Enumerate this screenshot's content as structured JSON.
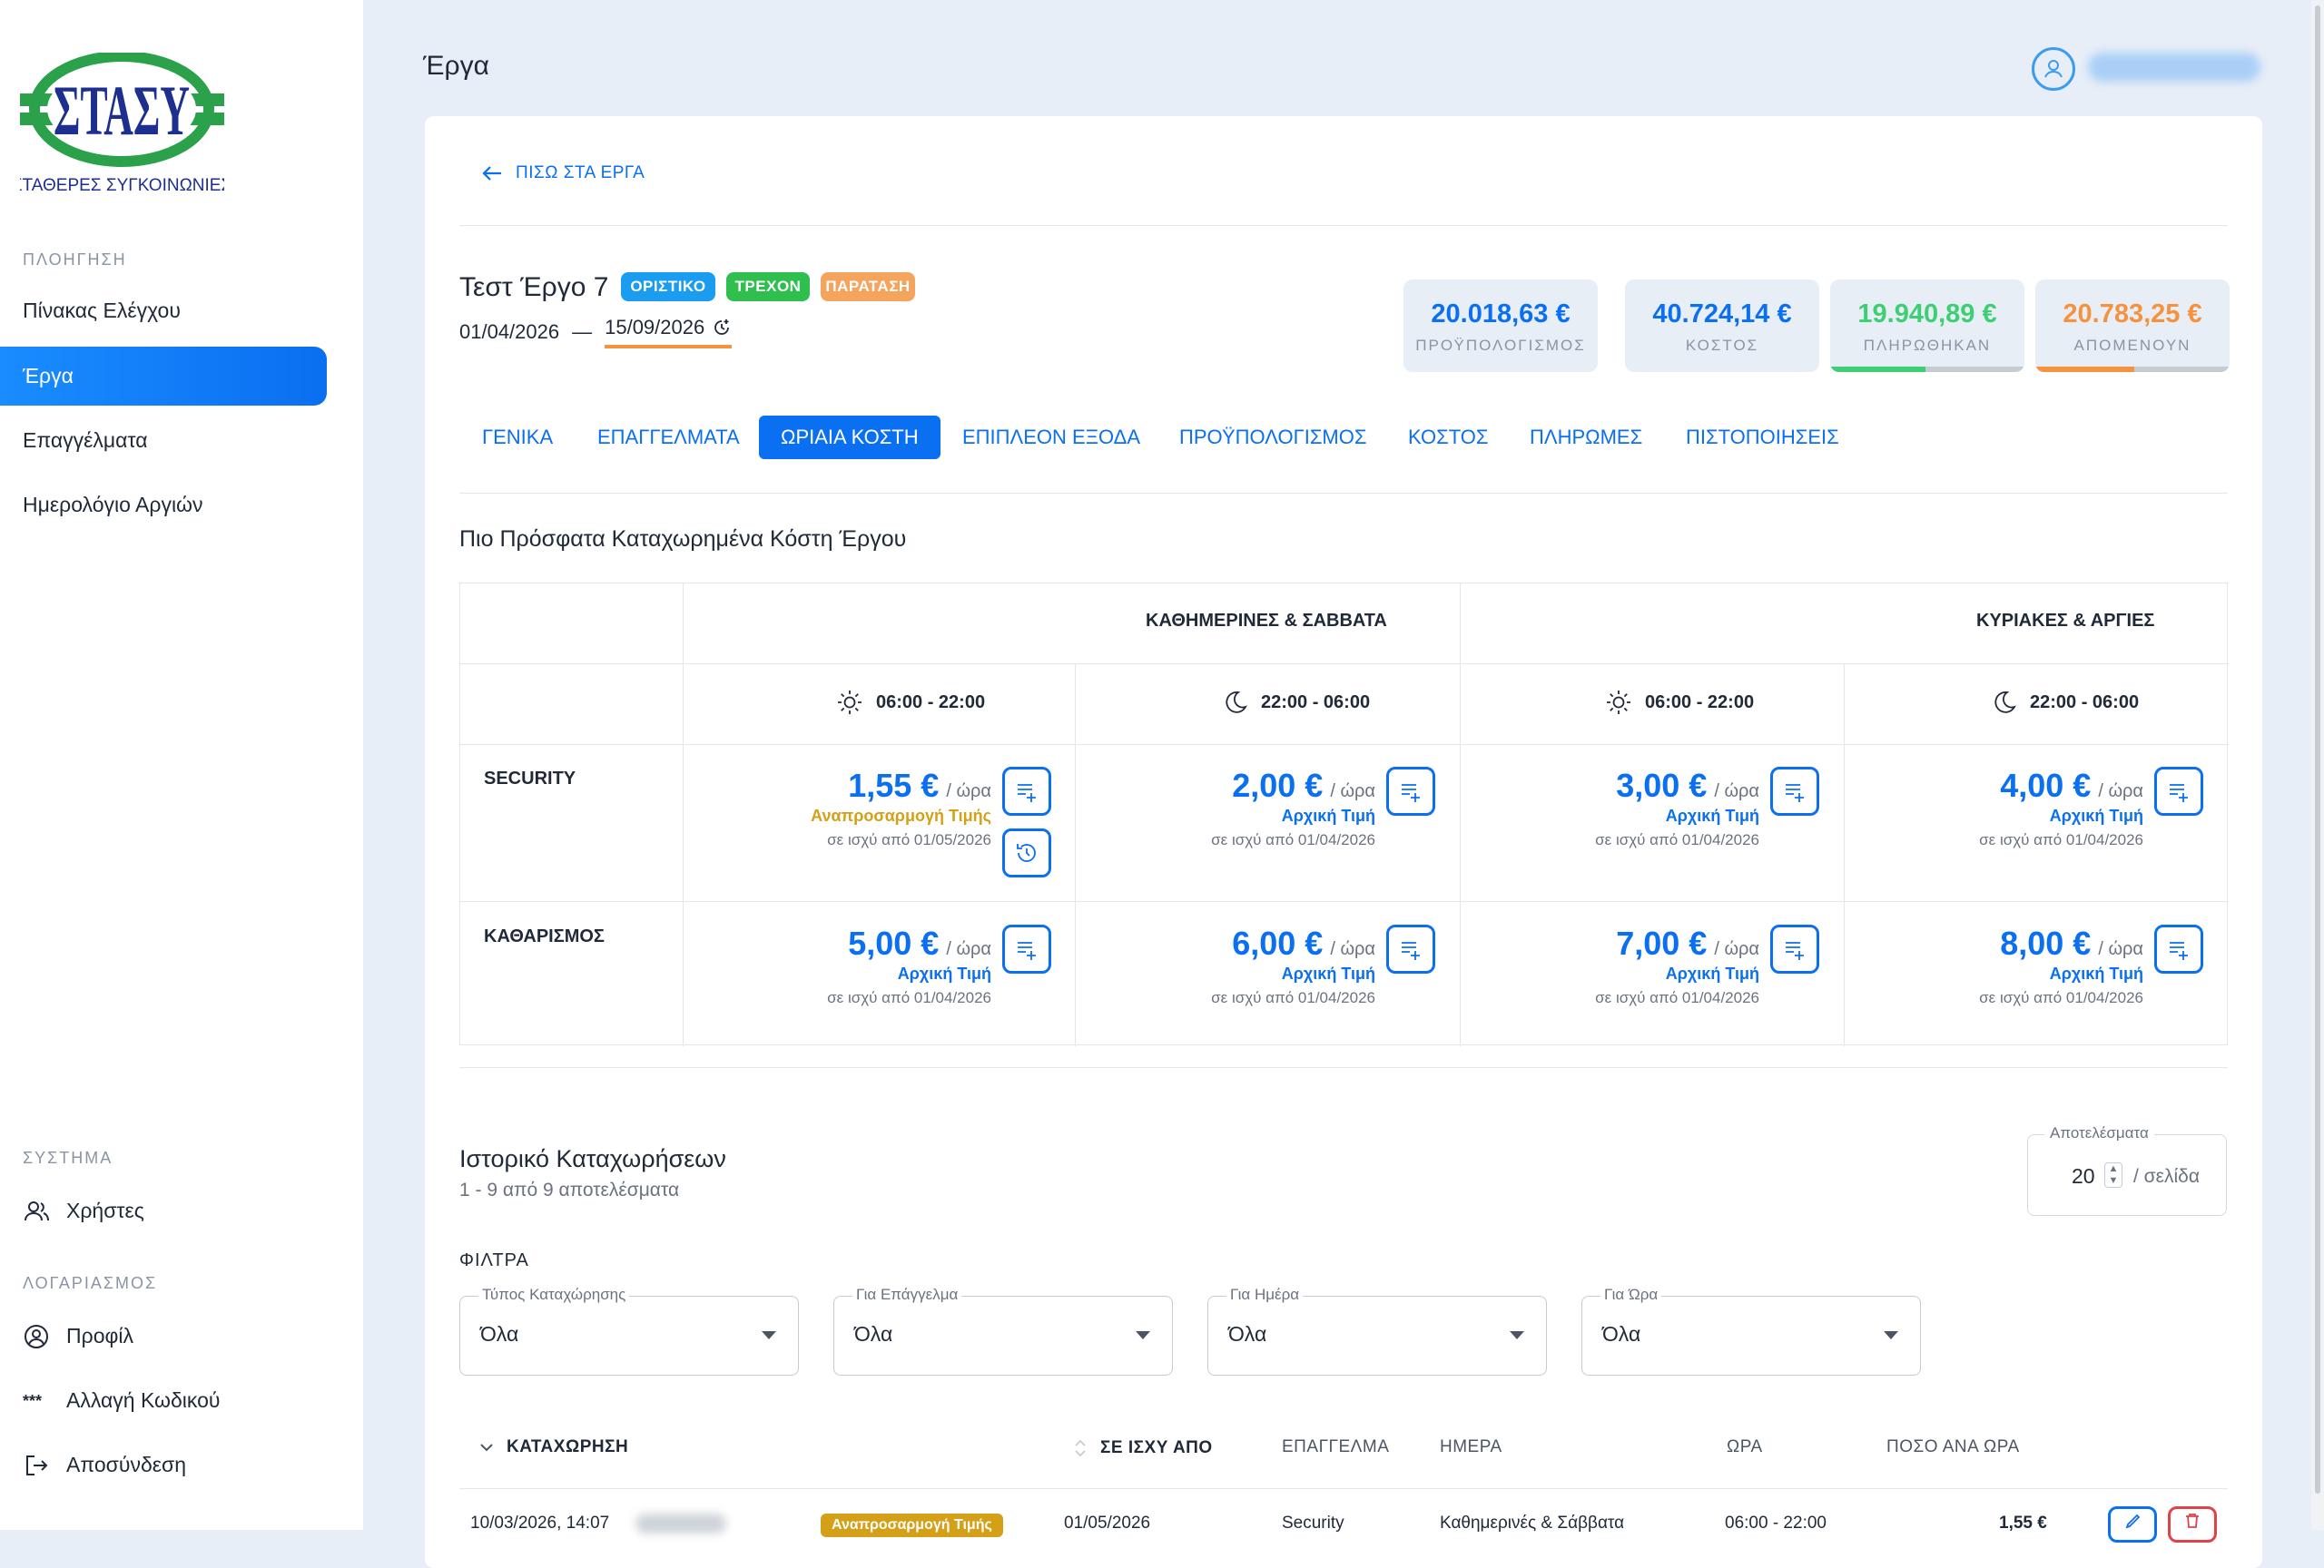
{
  "logo": {
    "text": "ΣΤΑΣΥ",
    "subtitle": "ΣΤΑΘΕΡΕΣ ΣΥΓΚΟΙΝΩΝΙΕΣ"
  },
  "sidebar": {
    "nav_title": "ΠΛΟΗΓΗΣΗ",
    "nav_items": [
      "Πίνακας Ελέγχου",
      "Έργα",
      "Επαγγέλματα",
      "Ημερολόγιο Αργιών"
    ],
    "system_title": "ΣΥΣΤΗΜΑ",
    "system_items": [
      "Χρήστες"
    ],
    "account_title": "ΛΟΓΑΡΙΑΣΜΟΣ",
    "account_items": [
      "Προφίλ",
      "Αλλαγή Κωδικού",
      "Αποσύνδεση"
    ]
  },
  "header": {
    "title": "Έργα"
  },
  "back_link": "ΠΙΣΩ ΣΤΑ ΕΡΓΑ",
  "project": {
    "title": "Τεστ Έργο 7",
    "badges": [
      "ΟΡΙΣΤΙΚΟ",
      "ΤΡΕΧΟΝ",
      "ΠΑΡΑΤΑΣΗ"
    ],
    "start_date": "01/04/2026",
    "separator": "—",
    "end_date": "15/09/2026"
  },
  "stats": [
    {
      "value": "20.018,63 €",
      "label": "ΠΡΟΫΠΟΛΟΓΙΣΜΟΣ",
      "color": "#0a6ff0"
    },
    {
      "value": "40.724,14 €",
      "label": "ΚΟΣΤΟΣ",
      "color": "#0a6ff0"
    },
    {
      "value": "19.940,89 €",
      "label": "ΠΛΗΡΩΘΗΚΑΝ",
      "color": "#3ecf74",
      "progress": 0.49
    },
    {
      "value": "20.783,25 €",
      "label": "ΑΠΟΜΕΝΟΥΝ",
      "color": "#f5923e",
      "progress": 0.51
    }
  ],
  "tabs": [
    "ΓΕΝΙΚΑ",
    "ΕΠΑΓΓΕΛΜΑΤΑ",
    "ΩΡΙΑΙΑ ΚΟΣΤΗ",
    "ΕΠΙΠΛΕΟΝ ΕΞΟΔΑ",
    "ΠΡΟΫΠΟΛΟΓΙΣΜΟΣ",
    "ΚΟΣΤΟΣ",
    "ΠΛΗΡΩΜΕΣ",
    "ΠΙΣΤΟΠΟΙΗΣΕΙΣ"
  ],
  "active_tab": "ΩΡΙΑΙΑ ΚΟΣΤΗ",
  "recent": {
    "title": "Πιο Πρόσφατα Καταχωρημένα Κόστη Έργου",
    "groups": [
      "ΚΑΘΗΜΕΡΙΝΕΣ & ΣΑΒΒΑΤΑ",
      "ΚΥΡΙΑΚΕΣ & ΑΡΓΙΕΣ"
    ],
    "periods": [
      "06:00 - 22:00",
      "22:00 - 06:00",
      "06:00 - 22:00",
      "22:00 - 06:00"
    ],
    "per_hour": "/ ώρα",
    "rows": [
      {
        "name": "SECURITY",
        "cells": [
          {
            "amount": "1,55 €",
            "tag": "Αναπροσαρμογή Τιμής",
            "since": "σε ισχύ από 01/05/2026"
          },
          {
            "amount": "2,00 €",
            "tag": "Αρχική Τιμή",
            "since": "σε ισχύ από 01/04/2026"
          },
          {
            "amount": "3,00 €",
            "tag": "Αρχική Τιμή",
            "since": "σε ισχύ από 01/04/2026"
          },
          {
            "amount": "4,00 €",
            "tag": "Αρχική Τιμή",
            "since": "σε ισχύ από 01/04/2026"
          }
        ]
      },
      {
        "name": "ΚΑΘΑΡΙΣΜΟΣ",
        "cells": [
          {
            "amount": "5,00 €",
            "tag": "Αρχική Τιμή",
            "since": "σε ισχύ από 01/04/2026"
          },
          {
            "amount": "6,00 €",
            "tag": "Αρχική Τιμή",
            "since": "σε ισχύ από 01/04/2026"
          },
          {
            "amount": "7,00 €",
            "tag": "Αρχική Τιμή",
            "since": "σε ισχύ από 01/04/2026"
          },
          {
            "amount": "8,00 €",
            "tag": "Αρχική Τιμή",
            "since": "σε ισχύ από 01/04/2026"
          }
        ]
      }
    ],
    "colors": {
      "adjust": "#d4a017",
      "initial": "#0a6ff0"
    }
  },
  "history": {
    "title": "Ιστορικό Καταχωρήσεων",
    "subtitle": "1 - 9 από 9 αποτελέσματα",
    "per_page_label": "Αποτελέσματα",
    "per_page_value": "20",
    "per_page_suffix": "/ σελίδα",
    "filters_title": "ΦΙΛΤΡΑ",
    "filters": [
      {
        "label": "Τύπος Καταχώρησης",
        "value": "Όλα"
      },
      {
        "label": "Για Επάγγελμα",
        "value": "Όλα"
      },
      {
        "label": "Για Ημέρα",
        "value": "Όλα"
      },
      {
        "label": "Για Ώρα",
        "value": "Όλα"
      }
    ],
    "columns": [
      "ΚΑΤΑΧΩΡΗΣΗ",
      "ΣΕ ΙΣΧΥ ΑΠΟ",
      "ΕΠΑΓΓΕΛΜΑ",
      "ΗΜΕΡΑ",
      "ΩΡΑ",
      "ΠΟΣΟ ΑΝΑ ΩΡΑ"
    ],
    "first_row": {
      "entry": "10/03/2026, 14:07 ",
      "tag": "Αναπροσαρμογή Τιμής",
      "since": "01/05/2026",
      "trade": "Security",
      "day": "Καθημερινές & Σάββατα",
      "time": "06:00 - 22:00",
      "amount": "1,55 €"
    }
  }
}
